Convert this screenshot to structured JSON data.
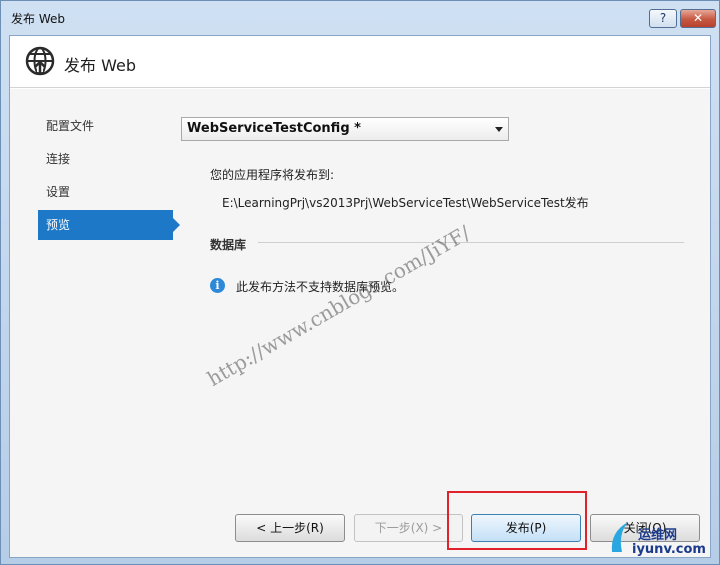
{
  "window": {
    "title": "发布 Web",
    "help_label": "?",
    "close_label": "✕"
  },
  "header": {
    "title": "发布 Web",
    "icon": "globe-publish-icon"
  },
  "nav": {
    "items": [
      {
        "label": "配置文件"
      },
      {
        "label": "连接"
      },
      {
        "label": "设置"
      },
      {
        "label": "预览"
      }
    ],
    "active": "预览"
  },
  "profile": {
    "selected": "WebServiceTestConfig *"
  },
  "publish": {
    "label": "您的应用程序将发布到:",
    "path": "E:\\LearningPrj\\vs2013Prj\\WebServiceTest\\WebServiceTest发布"
  },
  "database": {
    "title": "数据库",
    "info_icon": "i",
    "message": "此发布方法不支持数据库预览。"
  },
  "watermark": "http://www.cnblogs.com/JiYF/",
  "buttons": {
    "prev": "< 上一步(R)",
    "next": "下一步(X) >",
    "publish": "发布(P)",
    "close": "关闭(O)"
  },
  "logo": {
    "top": "运维网",
    "bottom": "iyunv.com"
  },
  "colors": {
    "accent": "#1d78c7",
    "highlight": "#e0232a"
  }
}
